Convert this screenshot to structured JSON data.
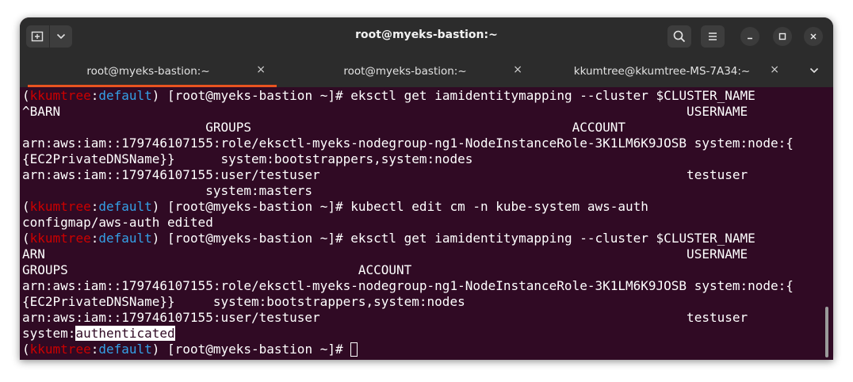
{
  "window": {
    "title": "root@myeks-bastion:~"
  },
  "tabs": [
    {
      "label": "root@myeks-bastion:~",
      "close": "×",
      "active": true
    },
    {
      "label": "root@myeks-bastion:~",
      "close": "×",
      "active": false
    },
    {
      "label": "kkumtree@kkumtree-MS-7A34:~",
      "close": "×",
      "active": false
    }
  ],
  "icons": {
    "new_tab": "new-tab-icon",
    "menu_dropdown": "chevron-down-icon",
    "search": "search-icon",
    "hamburger": "hamburger-menu-icon",
    "minimize": "minimize-icon",
    "maximize": "maximize-icon",
    "close": "close-icon",
    "tabs_overflow": "chevron-down-icon"
  },
  "colors": {
    "terminal_bg": "#300a24",
    "prompt_user": "#cc0000",
    "prompt_namespace": "#34a0e6",
    "active_tab_accent": "#e95420"
  },
  "prompt": {
    "open": "(",
    "user": "kkumtree",
    "sep": ":",
    "namespace": "default",
    "rest": ") [root@myeks-bastion ~]# "
  },
  "lines": [
    {
      "type": "prompt",
      "cmd": "eksctl get iamidentitymapping --cluster $CLUSTER_NAME"
    },
    {
      "type": "text",
      "text": "^BARN                                                                                  USERNAME"
    },
    {
      "type": "text",
      "text": "                        GROUPS                                          ACCOUNT"
    },
    {
      "type": "text",
      "text": "arn:aws:iam::179746107155:role/eksctl-myeks-nodegroup-ng1-NodeInstanceRole-3K1LM6K9JOSB system:node:{"
    },
    {
      "type": "text",
      "text": "{EC2PrivateDNSName}}      system:bootstrappers,system:nodes"
    },
    {
      "type": "text",
      "text": "arn:aws:iam::179746107155:user/testuser                                                testuser"
    },
    {
      "type": "text",
      "text": "                        system:masters"
    },
    {
      "type": "prompt",
      "cmd": "kubectl edit cm -n kube-system aws-auth"
    },
    {
      "type": "text",
      "text": "configmap/aws-auth edited"
    },
    {
      "type": "prompt",
      "cmd": "eksctl get iamidentitymapping --cluster $CLUSTER_NAME"
    },
    {
      "type": "text",
      "text": "ARN                                                                                    USERNAME"
    },
    {
      "type": "text",
      "text": "GROUPS                                      ACCOUNT"
    },
    {
      "type": "text",
      "text": "arn:aws:iam::179746107155:role/eksctl-myeks-nodegroup-ng1-NodeInstanceRole-3K1LM6K9JOSB system:node:{"
    },
    {
      "type": "text",
      "text": "{EC2PrivateDNSName}}     system:bootstrappers,system:nodes"
    },
    {
      "type": "text",
      "text": "arn:aws:iam::179746107155:user/testuser                                                testuser"
    },
    {
      "type": "highlight",
      "pre": "system:",
      "hl": "authenticated"
    },
    {
      "type": "prompt",
      "cmd": "",
      "cursor": true
    }
  ]
}
